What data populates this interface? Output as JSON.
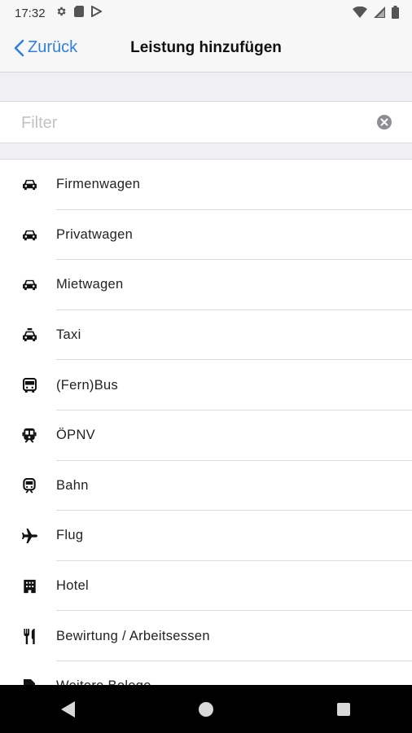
{
  "status_bar": {
    "time": "17:32",
    "left_icons": [
      "settings-icon",
      "sim-card-icon",
      "play-store-icon"
    ],
    "right_icons": [
      "wifi-icon",
      "signal-icon",
      "battery-icon"
    ]
  },
  "nav": {
    "back_label": "Zurück",
    "title": "Leistung hinzufügen"
  },
  "filter": {
    "placeholder": "Filter",
    "value": ""
  },
  "items": [
    {
      "label": "Firmenwagen",
      "icon": "car-icon"
    },
    {
      "label": "Privatwagen",
      "icon": "car-icon"
    },
    {
      "label": "Mietwagen",
      "icon": "car-icon"
    },
    {
      "label": "Taxi",
      "icon": "taxi-icon"
    },
    {
      "label": "(Fern)Bus",
      "icon": "bus-icon"
    },
    {
      "label": "ÖPNV",
      "icon": "tram-icon"
    },
    {
      "label": "Bahn",
      "icon": "train-icon"
    },
    {
      "label": "Flug",
      "icon": "airplane-icon"
    },
    {
      "label": "Hotel",
      "icon": "hotel-icon"
    },
    {
      "label": "Bewirtung / Arbeitsessen",
      "icon": "restaurant-icon"
    },
    {
      "label": "Weitere Belege",
      "icon": "receipt-icon"
    }
  ],
  "colors": {
    "accent": "#2f7fe0",
    "background": "#efeff4"
  }
}
